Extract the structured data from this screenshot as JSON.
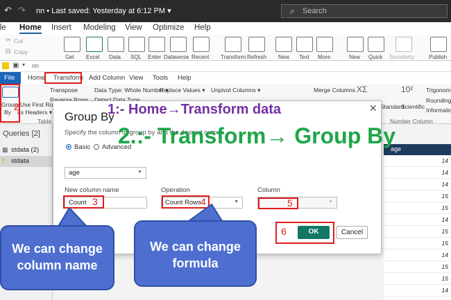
{
  "titlebar": {
    "title": "nn • Last saved: Yesterday at 6:12 PM ▾",
    "search_placeholder": "Search"
  },
  "ribbon": {
    "tabs": [
      "File",
      "Home",
      "Insert",
      "Modeling",
      "View",
      "Optimize",
      "Help"
    ],
    "active_tab": "Home",
    "clipboard": [
      "Cut",
      "Copy"
    ],
    "buttons": [
      "Get",
      "Excel",
      "Data",
      "SQL",
      "Enter",
      "Dataverse",
      "Recent",
      "Transform",
      "Refresh",
      "New",
      "Text",
      "More",
      "New",
      "Quick",
      "Sensitivity",
      "Publish"
    ]
  },
  "pq": {
    "title": "nn",
    "tabs": [
      "File",
      "Home",
      "Transform",
      "Add Column",
      "View",
      "Tools",
      "Help"
    ],
    "ribbon": {
      "group_by": "Group",
      "group_by2": "By",
      "use_first_row": "Use First Row",
      "as_headers": "as Headers ▾",
      "table_group": "Table",
      "transpose": "Transpose",
      "reverse_rows": "Reverse Rows",
      "data_type": "Data Type: Whole Number ▾",
      "detect_type": "Detect Data Type",
      "replace_values": "Replace Values ▾",
      "unpivot": "Unpivot Columns ▾",
      "merge_columns": "Merge Columns",
      "standard": "Standard",
      "scientific": "Scientific",
      "trigonometry": "Trigonometry ▾",
      "rounding": "Rounding ▾",
      "information": "Information ▾",
      "number_column": "Number Column",
      "sigma": "XΣ",
      "pow": "10²"
    }
  },
  "queries": {
    "header": "Queries [2]",
    "items": [
      {
        "label": "stdata (2)",
        "icon": "table-icon"
      },
      {
        "label": "stdata",
        "icon": "warning-icon"
      }
    ]
  },
  "grid": {
    "header": "age",
    "values": [
      "14",
      "14",
      "14",
      "15",
      "15",
      "14",
      "15",
      "15",
      "14",
      "15",
      "15",
      "14"
    ]
  },
  "dialog": {
    "title": "Group By",
    "description": "Specify the column to group by and the desired output.",
    "basic_label": "Basic",
    "advanced_label": "Advanced",
    "group_column": "age",
    "new_column_label": "New column name",
    "new_column_value": "Count",
    "operation_label": "Operation",
    "operation_value": "Count Rows",
    "column_label": "Column",
    "column_value": "",
    "ok_label": "OK",
    "cancel_label": "Cancel"
  },
  "annotations": {
    "step1": "1:- Home→Transform data",
    "step2": "2.:- Transform→ Group By",
    "n2": "2",
    "n3": "3",
    "n4": "4",
    "n5": "5",
    "n6": "6",
    "callout1": "We can change column name",
    "callout2": "We can change formula"
  },
  "colors": {
    "accent": "#117865",
    "annotation_red": "#e01b1b",
    "callout_blue": "#4e6fd0",
    "step1_purple": "#7330a0",
    "step2_green": "#1ea64a"
  }
}
